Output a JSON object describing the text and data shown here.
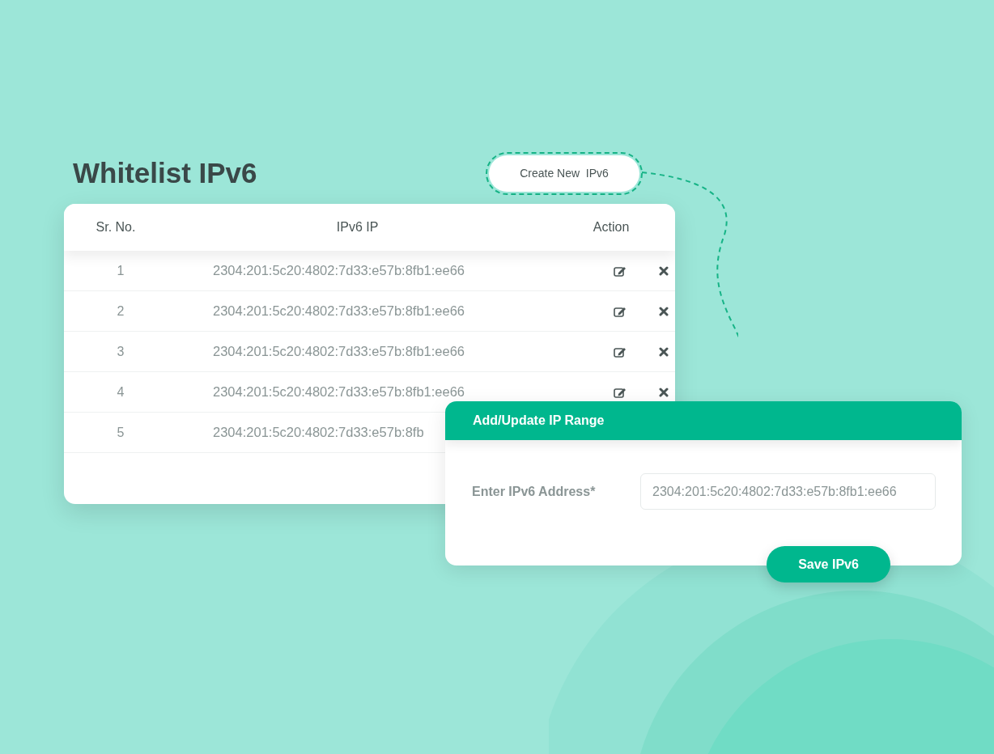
{
  "title": "Whitelist IPv6",
  "create_button": {
    "label": "Create New  IPv6"
  },
  "table": {
    "columns": [
      "Sr. No.",
      "IPv6 IP",
      "Action"
    ],
    "rows": [
      {
        "sr": "1",
        "ip": "2304:201:5c20:4802:7d33:e57b:8fb1:ee66",
        "actions": true
      },
      {
        "sr": "2",
        "ip": "2304:201:5c20:4802:7d33:e57b:8fb1:ee66",
        "actions": true
      },
      {
        "sr": "3",
        "ip": "2304:201:5c20:4802:7d33:e57b:8fb1:ee66",
        "actions": true
      },
      {
        "sr": "4",
        "ip": "2304:201:5c20:4802:7d33:e57b:8fb1:ee66",
        "actions": true
      },
      {
        "sr": "5",
        "ip": "2304:201:5c20:4802:7d33:e57b:8fb",
        "actions": false
      }
    ]
  },
  "form": {
    "title": "Add/Update IP Range",
    "label": "Enter IPv6 Address*",
    "value": "2304:201:5c20:4802:7d33:e57b:8fb1:ee66",
    "save_button": "Save IPv6"
  }
}
